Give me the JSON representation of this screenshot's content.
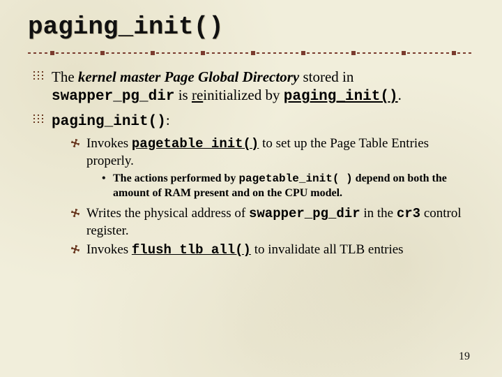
{
  "title": "paging_init()",
  "bullets": {
    "b1": {
      "t1": "The ",
      "t2": "kernel master Page Global Directory",
      "t3": " stored in ",
      "t4": "swapper_pg_dir",
      "t5": " is ",
      "t6": "re",
      "t7": "initialized by ",
      "t8": "paging_init()",
      "t9": "."
    },
    "b2": {
      "t1": "paging_init()",
      "t2": ":"
    },
    "sub": {
      "s1": {
        "t1": "Invokes ",
        "t2": "pagetable_init()",
        "t3": " to set up the Page Table Entries properly."
      },
      "s1a": {
        "t1": "The actions performed by ",
        "t2": "pagetable_init( )",
        "t3": " depend on both the amount of RAM present and on the CPU model."
      },
      "s2": {
        "t1": "Writes the physical address of ",
        "t2": "swapper_pg_dir",
        "t3": " in the ",
        "t4": "cr3",
        "t5": " control register."
      },
      "s3": {
        "t1": "Invokes ",
        "t2": "flush_tlb_all()",
        "t3": " to invalidate all TLB entries"
      }
    }
  },
  "page_number": "19"
}
